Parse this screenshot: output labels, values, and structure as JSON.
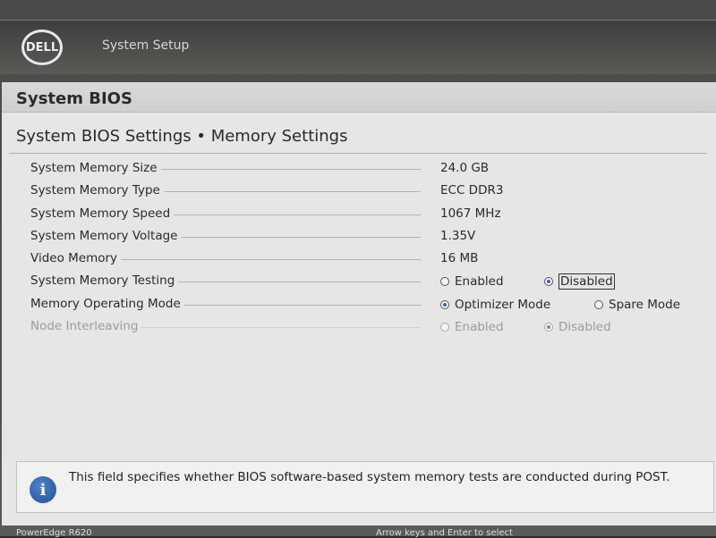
{
  "header": {
    "logo_text": "DELL",
    "app_title": "System Setup"
  },
  "page": {
    "title": "System BIOS",
    "breadcrumb": "System BIOS Settings • Memory Settings"
  },
  "settings": {
    "memory_size": {
      "label": "System Memory Size",
      "value": "24.0 GB"
    },
    "memory_type": {
      "label": "System Memory Type",
      "value": "ECC DDR3"
    },
    "memory_speed": {
      "label": "System Memory Speed",
      "value": "1067 MHz"
    },
    "memory_voltage": {
      "label": "System Memory Voltage",
      "value": "1.35V"
    },
    "video_memory": {
      "label": "Video Memory",
      "value": "16 MB"
    },
    "memory_testing": {
      "label": "System Memory Testing",
      "options": [
        "Enabled",
        "Disabled"
      ],
      "selected": "Disabled"
    },
    "operating_mode": {
      "label": "Memory Operating Mode",
      "options": [
        "Optimizer Mode",
        "Spare Mode"
      ],
      "selected": "Optimizer Mode"
    },
    "node_interleaving": {
      "label": "Node Interleaving",
      "options": [
        "Enabled",
        "Disabled"
      ],
      "selected": "Disabled",
      "disabled": true
    }
  },
  "help": {
    "text": "This field specifies whether BIOS software-based system memory tests are conducted during POST."
  },
  "footer": {
    "left": "PowerEdge R620",
    "right": "Arrow keys and Enter to select"
  },
  "colors": {
    "accent": "#2b63c6",
    "panel": "#e6e6e4",
    "header": "#4a4a48"
  }
}
